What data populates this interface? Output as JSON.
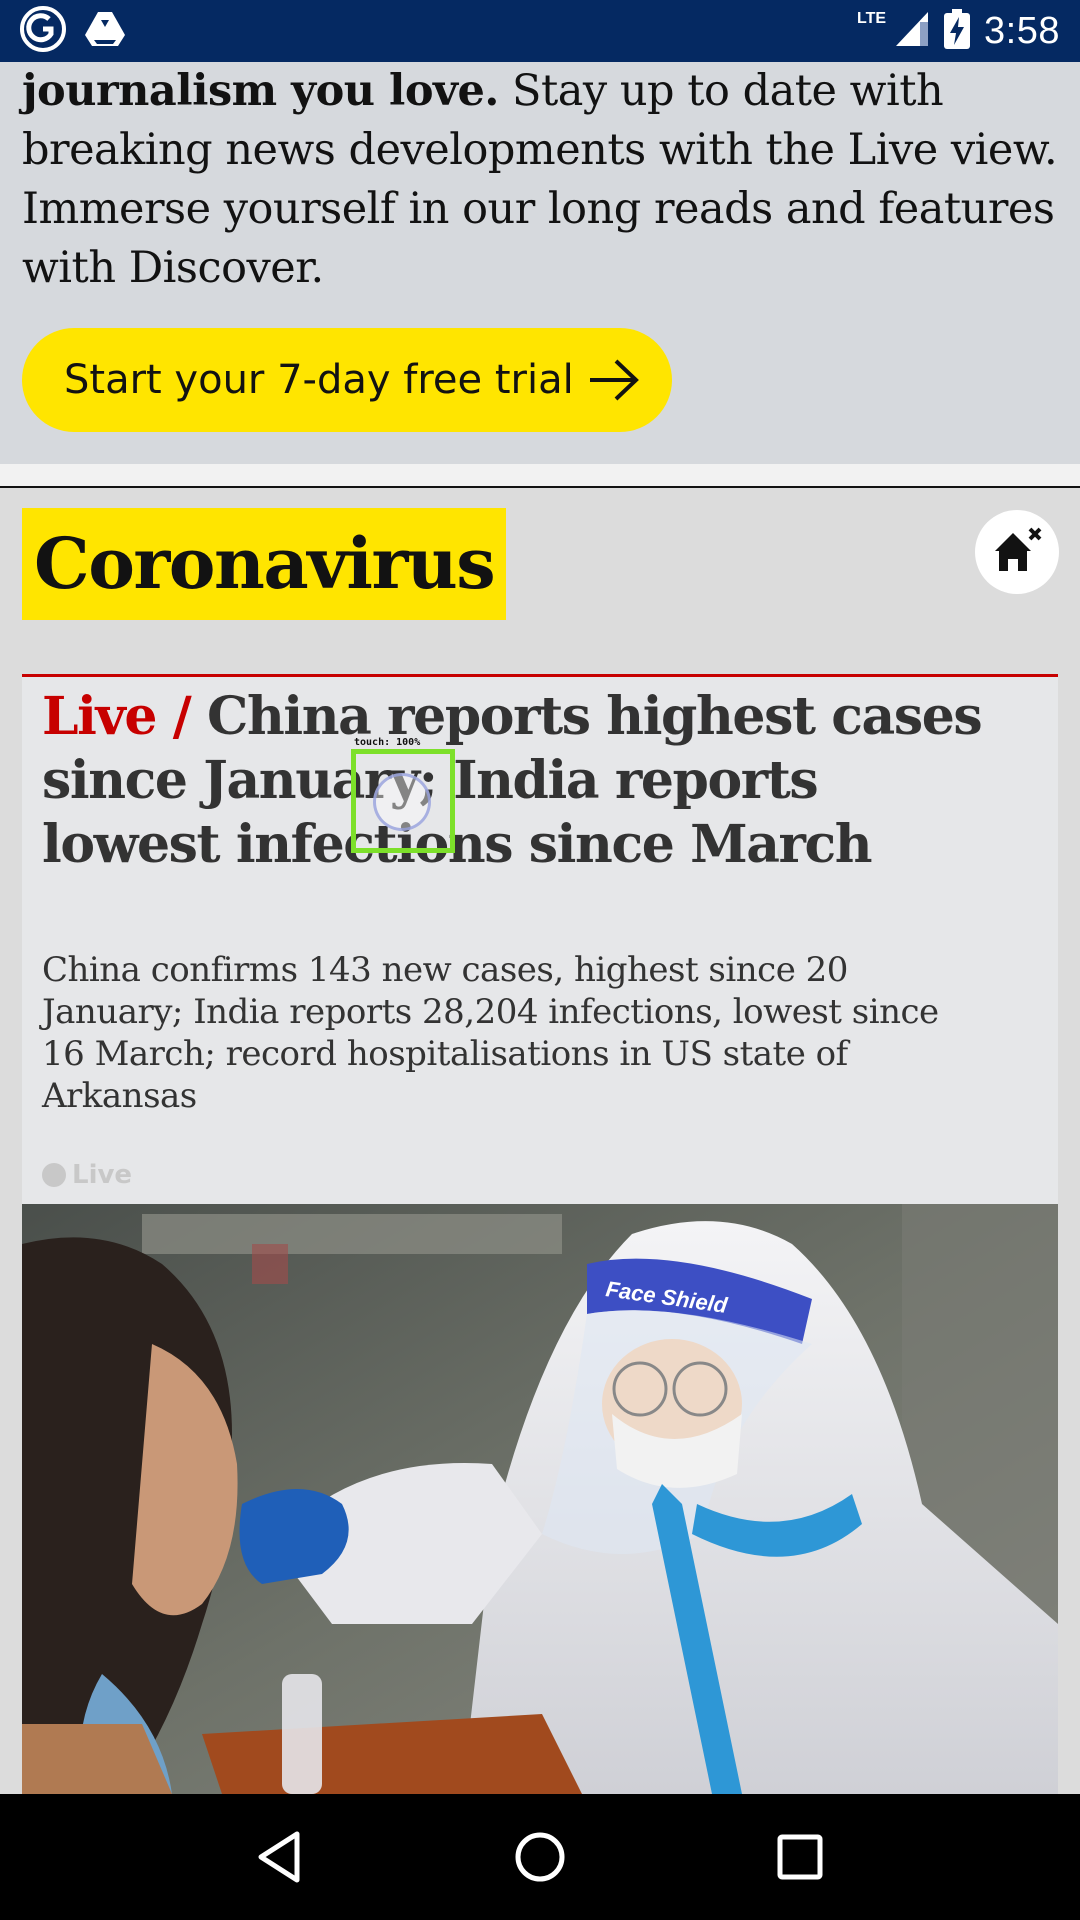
{
  "status_bar": {
    "network": "LTE",
    "time": "3:58"
  },
  "banner": {
    "bold_text": "journalism you love.",
    "text": " Stay up to date with breaking news developments with the Live view. Immerse yourself in our long reads and features with Discover.",
    "cta_label": "Start your 7-day free trial"
  },
  "section": {
    "title": "Coronavirus"
  },
  "article": {
    "kicker": "Live /",
    "headline": " China reports highest cases since January; India reports lowest infections since March",
    "standfirst": "China confirms 143 new cases, highest since 20 January; India reports 28,204 infections, lowest since 16 March; record hospitalisations in US state of Arkansas",
    "badge": "Live",
    "photo_text": "Face Shield"
  },
  "overlay": {
    "touch_label": "touch: 100%"
  },
  "colors": {
    "brand_blue": "#052962",
    "highlight_yellow": "#ffe500",
    "live_red": "#c70000"
  }
}
